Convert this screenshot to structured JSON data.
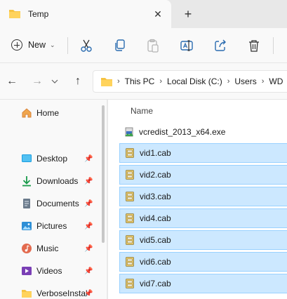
{
  "tab": {
    "title": "Temp",
    "close_glyph": "✕",
    "new_tab_glyph": "+"
  },
  "toolbar": {
    "new_label": "New",
    "new_chevron": "⌄",
    "icons": [
      "cut-icon",
      "copy-icon",
      "paste-icon",
      "rename-icon",
      "share-icon",
      "delete-icon"
    ]
  },
  "nav": {
    "back": "←",
    "forward": "→",
    "up": "↑"
  },
  "address": {
    "crumb_sep": "›",
    "crumbs": [
      "This PC",
      "Local Disk (C:)",
      "Users",
      "WD"
    ]
  },
  "sidebar": {
    "home": "Home",
    "items": [
      {
        "label": "Desktop",
        "icon": "desktop-icon",
        "pinned": true
      },
      {
        "label": "Downloads",
        "icon": "download-icon",
        "pinned": true
      },
      {
        "label": "Documents",
        "icon": "documents-icon",
        "pinned": true
      },
      {
        "label": "Pictures",
        "icon": "pictures-icon",
        "pinned": true
      },
      {
        "label": "Music",
        "icon": "music-icon",
        "pinned": true
      },
      {
        "label": "Videos",
        "icon": "videos-icon",
        "pinned": true
      },
      {
        "label": "VerboseInstal",
        "icon": "folder-icon",
        "pinned": true
      }
    ],
    "pin_glyph": "📌"
  },
  "main": {
    "column_name": "Name",
    "files": [
      {
        "name": "vcredist_2013_x64.exe",
        "type": "exe",
        "selected": false
      },
      {
        "name": "vid1.cab",
        "type": "cab",
        "selected": true
      },
      {
        "name": "vid2.cab",
        "type": "cab",
        "selected": true
      },
      {
        "name": "vid3.cab",
        "type": "cab",
        "selected": true
      },
      {
        "name": "vid4.cab",
        "type": "cab",
        "selected": true
      },
      {
        "name": "vid5.cab",
        "type": "cab",
        "selected": true
      },
      {
        "name": "vid6.cab",
        "type": "cab",
        "selected": true
      },
      {
        "name": "vid7.cab",
        "type": "cab",
        "selected": true
      }
    ]
  },
  "colors": {
    "folder": "#f6c342",
    "selection_bg": "#cce8ff",
    "selection_border": "#99d1ff",
    "accent": "#0067c0"
  }
}
